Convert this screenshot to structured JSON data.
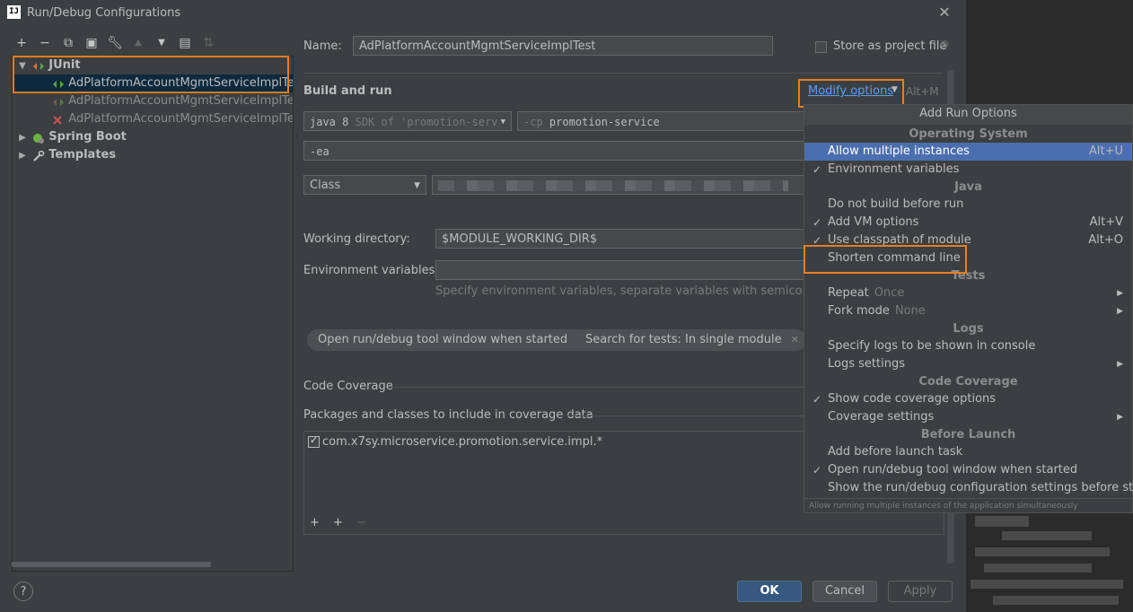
{
  "window": {
    "title": "Run/Debug Configurations",
    "logo": "IJ"
  },
  "toolbar": {
    "icons": [
      "add-icon",
      "remove-icon",
      "copy-icon",
      "save-icon",
      "wrench-icon",
      "move-up-icon",
      "move-down-icon",
      "new-folder-icon",
      "sort-icon"
    ]
  },
  "tree": {
    "junit_label": "JUnit",
    "items": [
      "AdPlatformAccountMgmtServiceImplTest",
      "AdPlatformAccountMgmtServiceImplTest.lis",
      "AdPlatformAccountMgmtServiceImplTest.lis"
    ],
    "spring_boot": "Spring Boot",
    "templates": "Templates"
  },
  "form": {
    "name_label": "Name:",
    "name_value": "AdPlatformAccountMgmtServiceImplTest",
    "store_label": "Store as project file",
    "build_run": "Build and run",
    "modify_options": "Modify options",
    "modify_shortcut": "Alt+M",
    "jdk_value": "java 8",
    "jdk_hint": "SDK of 'promotion-serv",
    "cp_flag": "-cp",
    "cp_value": "promotion-service",
    "vm_options": "-ea",
    "test_kind": "Class",
    "workdir_label": "Working directory:",
    "workdir_value": "$MODULE_WORKING_DIR$",
    "env_label": "Environment variables:",
    "env_hint": "Specify environment variables, separate variables with semicolons. Exa",
    "chip1": "Open run/debug tool window when started",
    "chip2": "Search for tests: In single module",
    "coverage_label": "Code Coverage",
    "coverage_pkgs_label": "Packages and classes to include in coverage data",
    "coverage_entry": "com.x7sy.microservice.promotion.service.impl.*"
  },
  "buttons": {
    "ok": "OK",
    "cancel": "Cancel",
    "apply": "Apply",
    "help": "?"
  },
  "popup": {
    "title": "Add Run Options",
    "groups": {
      "os": "Operating System",
      "java": "Java",
      "tests": "Tests",
      "logs": "Logs",
      "coverage": "Code Coverage",
      "before": "Before Launch"
    },
    "items": {
      "allow_multiple": {
        "label": "Allow multiple instances",
        "shortcut": "Alt+U"
      },
      "env_vars": {
        "label": "Environment variables"
      },
      "no_build": {
        "label": "Do not build before run"
      },
      "vm_options": {
        "label": "Add VM options",
        "shortcut": "Alt+V"
      },
      "classpath": {
        "label": "Use classpath of module",
        "shortcut": "Alt+O"
      },
      "shorten": {
        "label": "Shorten command line"
      },
      "repeat": {
        "label": "Repeat",
        "sub": "Once"
      },
      "fork": {
        "label": "Fork mode",
        "sub": "None"
      },
      "logs_console": {
        "label": "Specify logs to be shown in console"
      },
      "logs_settings": {
        "label": "Logs settings"
      },
      "show_coverage": {
        "label": "Show code coverage options"
      },
      "coverage_settings": {
        "label": "Coverage settings"
      },
      "add_before": {
        "label": "Add before launch task"
      },
      "open_tool": {
        "label": "Open run/debug tool window when started"
      },
      "show_settings": {
        "label": "Show the run/debug configuration settings before start"
      }
    },
    "footer": "Allow running multiple instances of the application simultaneously"
  }
}
